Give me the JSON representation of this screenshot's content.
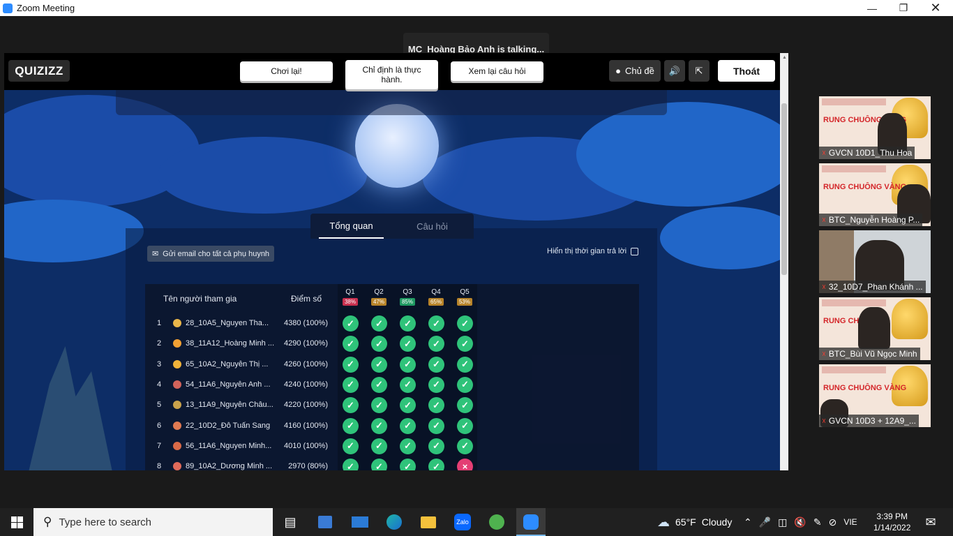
{
  "window": {
    "title": "Zoom Meeting"
  },
  "meeting": {
    "talking_indicator": "MC_Hoàng Bảo Anh is talking..."
  },
  "quiz": {
    "logo": "QUIZIZZ",
    "buttons": {
      "replay": "Chơi lại!",
      "assign_practice": "Chỉ định là thực hành.",
      "review_questions": "Xem lại câu hỏi",
      "theme": "Chủ đề",
      "exit": "Thoát"
    },
    "tabs": {
      "overview": "Tổng quan",
      "questions": "Câu hỏi"
    },
    "email_parents": "Gửi email cho tất cả phụ huynh",
    "show_answer_time": "Hiển thị thời gian trả lời",
    "table": {
      "headers": {
        "participant": "Tên người tham gia",
        "score": "Điểm số"
      },
      "questions": [
        {
          "label": "Q1",
          "pct": "38%",
          "color": "#c9304f"
        },
        {
          "label": "Q2",
          "pct": "47%",
          "color": "#b8842a"
        },
        {
          "label": "Q3",
          "pct": "85%",
          "color": "#1f9a62"
        },
        {
          "label": "Q4",
          "pct": "65%",
          "color": "#b8842a"
        },
        {
          "label": "Q5",
          "pct": "53%",
          "color": "#b8842a"
        }
      ],
      "rows": [
        {
          "rank": "1",
          "name": "28_10A5_Nguyen Tha...",
          "score": "4380 (100%)",
          "results": [
            true,
            true,
            true,
            true,
            true
          ]
        },
        {
          "rank": "2",
          "name": "38_11A12_Hoàng Minh ...",
          "score": "4290 (100%)",
          "results": [
            true,
            true,
            true,
            true,
            true
          ]
        },
        {
          "rank": "3",
          "name": "65_10A2_Nguyễn Thị ...",
          "score": "4260 (100%)",
          "results": [
            true,
            true,
            true,
            true,
            true
          ]
        },
        {
          "rank": "4",
          "name": "54_11A6_Nguyễn Anh ...",
          "score": "4240 (100%)",
          "results": [
            true,
            true,
            true,
            true,
            true
          ]
        },
        {
          "rank": "5",
          "name": "13_11A9_Nguyễn Châu...",
          "score": "4220 (100%)",
          "results": [
            true,
            true,
            true,
            true,
            true
          ]
        },
        {
          "rank": "6",
          "name": "22_10D2_Đỗ Tuấn Sang",
          "score": "4160 (100%)",
          "results": [
            true,
            true,
            true,
            true,
            true
          ]
        },
        {
          "rank": "7",
          "name": "56_11A6_Nguyen Minh...",
          "score": "4010 (100%)",
          "results": [
            true,
            true,
            true,
            true,
            true
          ]
        },
        {
          "rank": "8",
          "name": "89_10A2_Dương Minh ...",
          "score": "2970 (80%)",
          "results": [
            true,
            true,
            true,
            true,
            false
          ]
        }
      ]
    }
  },
  "participants": [
    {
      "name": "GVCN 10D1_Thu Hoa",
      "banner": "RUNG CHUÔNG VÀNG"
    },
    {
      "name": "BTC_Nguyễn Hoàng P...",
      "banner": "RUNG CHUÔNG VÀNG"
    },
    {
      "name": "32_10D7_Phan Khánh ...",
      "banner": ""
    },
    {
      "name": "BTC_Bùi Vũ Ngọc Minh",
      "banner": "RUNG CH VÀN"
    },
    {
      "name": "GVCN 10D3 + 12A9_...",
      "banner": "RUNG CHUÔNG VÀNG"
    }
  ],
  "taskbar": {
    "search_placeholder": "Type here to search",
    "weather_temp": "65°F",
    "weather_desc": "Cloudy",
    "language": "VIE",
    "time": "3:39 PM",
    "date": "1/14/2022"
  }
}
